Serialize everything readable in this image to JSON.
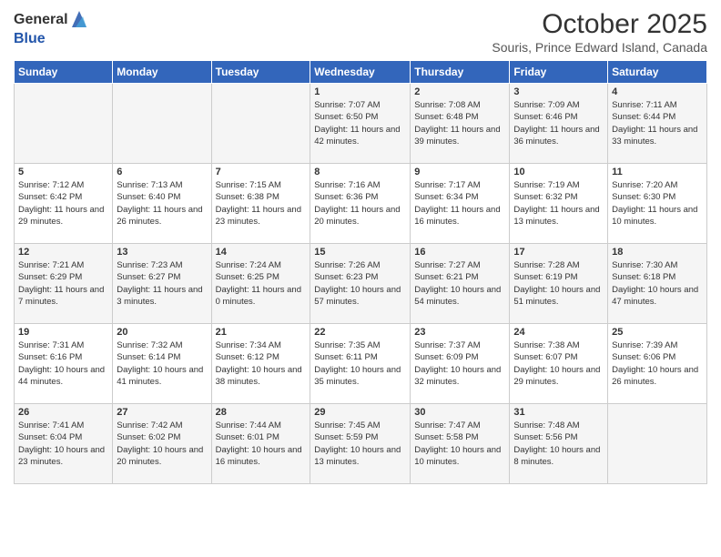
{
  "logo": {
    "text_general": "General",
    "text_blue": "Blue"
  },
  "title": {
    "month_year": "October 2025",
    "location": "Souris, Prince Edward Island, Canada"
  },
  "days_of_week": [
    "Sunday",
    "Monday",
    "Tuesday",
    "Wednesday",
    "Thursday",
    "Friday",
    "Saturday"
  ],
  "weeks": [
    [
      {
        "day": "",
        "info": ""
      },
      {
        "day": "",
        "info": ""
      },
      {
        "day": "",
        "info": ""
      },
      {
        "day": "1",
        "info": "Sunrise: 7:07 AM\nSunset: 6:50 PM\nDaylight: 11 hours and 42 minutes."
      },
      {
        "day": "2",
        "info": "Sunrise: 7:08 AM\nSunset: 6:48 PM\nDaylight: 11 hours and 39 minutes."
      },
      {
        "day": "3",
        "info": "Sunrise: 7:09 AM\nSunset: 6:46 PM\nDaylight: 11 hours and 36 minutes."
      },
      {
        "day": "4",
        "info": "Sunrise: 7:11 AM\nSunset: 6:44 PM\nDaylight: 11 hours and 33 minutes."
      }
    ],
    [
      {
        "day": "5",
        "info": "Sunrise: 7:12 AM\nSunset: 6:42 PM\nDaylight: 11 hours and 29 minutes."
      },
      {
        "day": "6",
        "info": "Sunrise: 7:13 AM\nSunset: 6:40 PM\nDaylight: 11 hours and 26 minutes."
      },
      {
        "day": "7",
        "info": "Sunrise: 7:15 AM\nSunset: 6:38 PM\nDaylight: 11 hours and 23 minutes."
      },
      {
        "day": "8",
        "info": "Sunrise: 7:16 AM\nSunset: 6:36 PM\nDaylight: 11 hours and 20 minutes."
      },
      {
        "day": "9",
        "info": "Sunrise: 7:17 AM\nSunset: 6:34 PM\nDaylight: 11 hours and 16 minutes."
      },
      {
        "day": "10",
        "info": "Sunrise: 7:19 AM\nSunset: 6:32 PM\nDaylight: 11 hours and 13 minutes."
      },
      {
        "day": "11",
        "info": "Sunrise: 7:20 AM\nSunset: 6:30 PM\nDaylight: 11 hours and 10 minutes."
      }
    ],
    [
      {
        "day": "12",
        "info": "Sunrise: 7:21 AM\nSunset: 6:29 PM\nDaylight: 11 hours and 7 minutes."
      },
      {
        "day": "13",
        "info": "Sunrise: 7:23 AM\nSunset: 6:27 PM\nDaylight: 11 hours and 3 minutes."
      },
      {
        "day": "14",
        "info": "Sunrise: 7:24 AM\nSunset: 6:25 PM\nDaylight: 11 hours and 0 minutes."
      },
      {
        "day": "15",
        "info": "Sunrise: 7:26 AM\nSunset: 6:23 PM\nDaylight: 10 hours and 57 minutes."
      },
      {
        "day": "16",
        "info": "Sunrise: 7:27 AM\nSunset: 6:21 PM\nDaylight: 10 hours and 54 minutes."
      },
      {
        "day": "17",
        "info": "Sunrise: 7:28 AM\nSunset: 6:19 PM\nDaylight: 10 hours and 51 minutes."
      },
      {
        "day": "18",
        "info": "Sunrise: 7:30 AM\nSunset: 6:18 PM\nDaylight: 10 hours and 47 minutes."
      }
    ],
    [
      {
        "day": "19",
        "info": "Sunrise: 7:31 AM\nSunset: 6:16 PM\nDaylight: 10 hours and 44 minutes."
      },
      {
        "day": "20",
        "info": "Sunrise: 7:32 AM\nSunset: 6:14 PM\nDaylight: 10 hours and 41 minutes."
      },
      {
        "day": "21",
        "info": "Sunrise: 7:34 AM\nSunset: 6:12 PM\nDaylight: 10 hours and 38 minutes."
      },
      {
        "day": "22",
        "info": "Sunrise: 7:35 AM\nSunset: 6:11 PM\nDaylight: 10 hours and 35 minutes."
      },
      {
        "day": "23",
        "info": "Sunrise: 7:37 AM\nSunset: 6:09 PM\nDaylight: 10 hours and 32 minutes."
      },
      {
        "day": "24",
        "info": "Sunrise: 7:38 AM\nSunset: 6:07 PM\nDaylight: 10 hours and 29 minutes."
      },
      {
        "day": "25",
        "info": "Sunrise: 7:39 AM\nSunset: 6:06 PM\nDaylight: 10 hours and 26 minutes."
      }
    ],
    [
      {
        "day": "26",
        "info": "Sunrise: 7:41 AM\nSunset: 6:04 PM\nDaylight: 10 hours and 23 minutes."
      },
      {
        "day": "27",
        "info": "Sunrise: 7:42 AM\nSunset: 6:02 PM\nDaylight: 10 hours and 20 minutes."
      },
      {
        "day": "28",
        "info": "Sunrise: 7:44 AM\nSunset: 6:01 PM\nDaylight: 10 hours and 16 minutes."
      },
      {
        "day": "29",
        "info": "Sunrise: 7:45 AM\nSunset: 5:59 PM\nDaylight: 10 hours and 13 minutes."
      },
      {
        "day": "30",
        "info": "Sunrise: 7:47 AM\nSunset: 5:58 PM\nDaylight: 10 hours and 10 minutes."
      },
      {
        "day": "31",
        "info": "Sunrise: 7:48 AM\nSunset: 5:56 PM\nDaylight: 10 hours and 8 minutes."
      },
      {
        "day": "",
        "info": ""
      }
    ]
  ]
}
